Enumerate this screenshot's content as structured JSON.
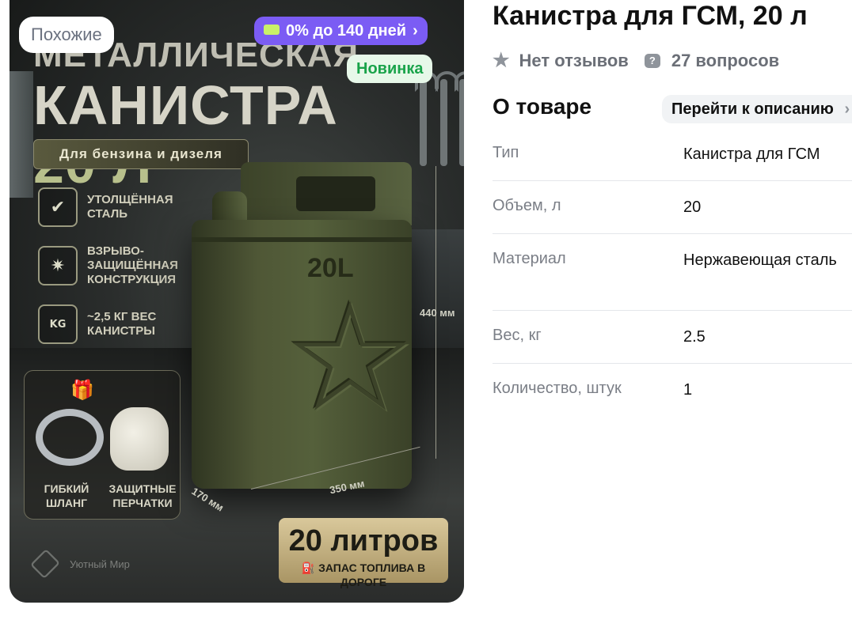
{
  "image_badges": {
    "similar": "Похожие",
    "installment": "0% до 140 дней",
    "new": "Новинка"
  },
  "product_image": {
    "headline_line1": "Металлическая",
    "headline_word": "Канистра",
    "headline_size": "20 л",
    "fuel_banner": "Для бензина и дизеля",
    "features": [
      {
        "icon": "shield-check-icon",
        "text": "Утолщённая сталь"
      },
      {
        "icon": "explosion-icon",
        "text": "Взрыво-защищённая конструкция"
      },
      {
        "icon": "weight-kg-icon",
        "text": "~2,5 кг вес канистры"
      }
    ],
    "gifts": {
      "icon": "gift-icon",
      "hose_label": "Гибкий шланг",
      "gloves_label": "Защитные перчатки"
    },
    "canister_mark": "20L",
    "dim_height": "440 мм",
    "dim_width": "350 мм",
    "dim_depth": "170 мм",
    "liters_badge_big": "20 литров",
    "liters_badge_small": "Запас топлива в дороге",
    "brand": "Уютный Мир"
  },
  "product": {
    "title": "Канистра для ГСМ, 20 л",
    "reviews": "Нет отзывов",
    "questions": "27 вопросов"
  },
  "about": {
    "title": "О товаре",
    "goto_description": "Перейти к описанию",
    "specs": [
      {
        "key": "Тип",
        "value": "Канистра для ГСМ"
      },
      {
        "key": "Объем, л",
        "value": "20"
      },
      {
        "key": "Материал",
        "value": "Нержавеющая сталь"
      },
      {
        "key": "Вес, кг",
        "value": "2.5"
      },
      {
        "key": "Количество, штук",
        "value": "1"
      }
    ]
  }
}
